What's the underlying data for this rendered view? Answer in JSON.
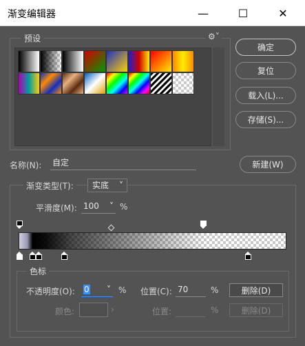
{
  "window": {
    "title": "渐变编辑器",
    "minimize": "—",
    "maximize": "☐",
    "close": "✕"
  },
  "presets": {
    "label": "预设",
    "gear_icon": "gear-icon",
    "swatches": [
      "linear-gradient(90deg,#000,#fff)",
      "checker-black",
      "linear-gradient(90deg,#000,#fff)",
      "linear-gradient(135deg,#d00000,#009a00)",
      "linear-gradient(135deg,#2030c0,#ffd000)",
      "linear-gradient(90deg,#2020d0,#d00000,#ffee00)",
      "linear-gradient(135deg,#ff0000,#ffea00)",
      "linear-gradient(90deg,#ff8800,#ffee00,#ff8800)",
      "linear-gradient(90deg,#b000b0,#00a0a0,#ffcc00)",
      "linear-gradient(135deg,#1030c0,#ff8a00,#1030c0,#ff8a00)",
      "linear-gradient(135deg,#5a2c10,#e8b080,#5a2c10,#e8b080)",
      "linear-gradient(135deg,#0060c0,#ffffff,#e0a000)",
      "linear-gradient(135deg,#ff0000,#ffff00,#00ff00,#00ffff,#0000ff,#ff00ff)",
      "linear-gradient(135deg,#ff0000,#ffff00,#00ff00,#00ffff,#0000ff,#ff00ff,#ff0000)",
      "repeating-linear-gradient(135deg,#000 0,#000 3px,#fff 3px,#fff 6px)",
      "checker"
    ]
  },
  "buttons": {
    "ok": "确定",
    "reset": "复位",
    "load": "载入(L)...",
    "save": "存储(S)...",
    "new": "新建(W)",
    "delete_opacity": "删除(D)",
    "delete_color": "删除(D)"
  },
  "name": {
    "label": "名称(N):",
    "value": "自定"
  },
  "gradient_type": {
    "label": "渐变类型(T):",
    "value": "实底"
  },
  "smoothness": {
    "label": "平滑度(M):",
    "value": "100",
    "unit": "%"
  },
  "stops": {
    "label": "色标",
    "opacity_label": "不透明度(O):",
    "opacity_value": "0",
    "opacity_unit": "%",
    "location_label": "位置(C):",
    "location_value": "70",
    "location_unit": "%",
    "color_label": "颜色:",
    "color_location_label": "位置:",
    "color_location_unit": "%"
  },
  "colors": {
    "background": "#535353",
    "titlebar": "#ffffff",
    "accent": "#3c8cff"
  }
}
